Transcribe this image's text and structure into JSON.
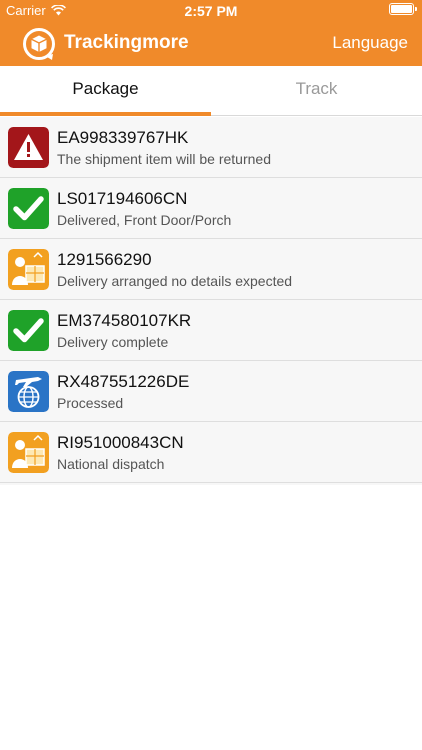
{
  "status_bar": {
    "carrier": "Carrier",
    "time": "2:57 PM"
  },
  "header": {
    "title": "Trackingmore",
    "language_label": "Language",
    "brand_color": "#f08a2a"
  },
  "tabs": [
    {
      "label": "Package",
      "active": true
    },
    {
      "label": "Track",
      "active": false
    }
  ],
  "packages": [
    {
      "number": "EA998339767HK",
      "status": "The shipment item will be returned",
      "icon": "warning-icon"
    },
    {
      "number": "LS017194606CN",
      "status": "Delivered, Front Door/Porch",
      "icon": "delivered-check-icon"
    },
    {
      "number": "1291566290",
      "status": "Delivery arranged no details expected",
      "icon": "courier-package-icon"
    },
    {
      "number": "EM374580107KR",
      "status": "Delivery complete",
      "icon": "delivered-check-icon"
    },
    {
      "number": "RX487551226DE",
      "status": "Processed",
      "icon": "air-transit-icon"
    },
    {
      "number": "RI951000843CN",
      "status": "National dispatch",
      "icon": "courier-package-icon"
    }
  ]
}
